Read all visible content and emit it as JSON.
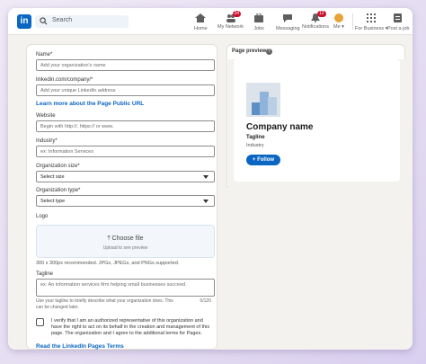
{
  "nav": {
    "logo": "in",
    "search_placeholder": "Search",
    "items": [
      {
        "label": "Home",
        "icon": "home-icon"
      },
      {
        "label": "My Network",
        "icon": "network-icon",
        "badge": "34"
      },
      {
        "label": "Jobs",
        "icon": "jobs-icon"
      },
      {
        "label": "Messaging",
        "icon": "messaging-icon"
      },
      {
        "label": "Notifications",
        "icon": "bell-icon",
        "badge": "12"
      },
      {
        "label": "Me",
        "icon": "avatar"
      },
      {
        "label": "For Business",
        "icon": "grid-icon"
      },
      {
        "label": "Post a job",
        "icon": "post-job-icon"
      }
    ]
  },
  "form": {
    "name_label": "Name*",
    "name_placeholder": "Add your organization's name",
    "url_label": "linkedin.com/company/*",
    "url_placeholder": "Add your unique LinkedIn address",
    "url_link": "Learn more about the Page Public URL",
    "website_label": "Website",
    "website_placeholder": "Begin with http://, https:// or www.",
    "industry_label": "Industry*",
    "industry_placeholder": "ex: Information Services",
    "size_label": "Organization size*",
    "size_value": "Select size",
    "type_label": "Organization type*",
    "type_value": "Select type",
    "logo_label": "Logo",
    "logo_choose": "Choose file",
    "logo_sub": "Upload to see preview",
    "logo_note": "300 x 300px recommended. JPGs, JPEGs, and PNGs supported.",
    "tagline_label": "Tagline",
    "tagline_placeholder": "ex: An information services firm helping small businesses succeed.",
    "tagline_hint": "Use your tagline to briefly describe what your organization does. This can be changed later.",
    "tagline_counter": "0/120",
    "verify_text": "I verify that I am an authorized representative of this organization and have the right to act on its behalf in the creation and management of this page. The organization and I agree to the additional terms for Pages.",
    "terms_link": "Read the LinkedIn Pages Terms"
  },
  "preview": {
    "title": "Page preview",
    "company_name": "Company name",
    "tagline": "Tagline",
    "industry": "Industry",
    "follow_label": "+ Follow"
  },
  "colors": {
    "brand": "#0a66c2",
    "badge": "#cb112d"
  }
}
